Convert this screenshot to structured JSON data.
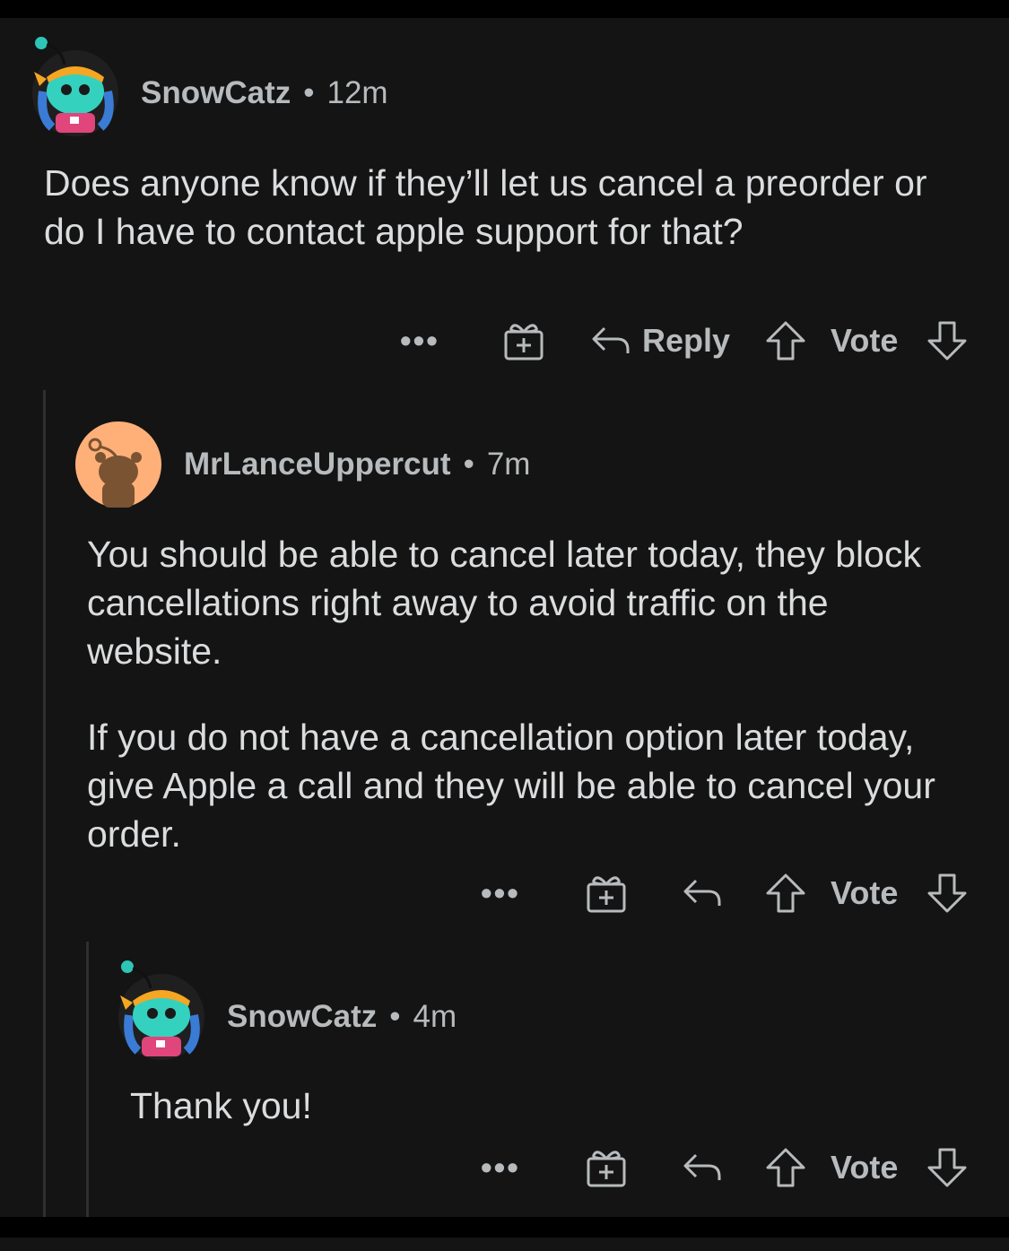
{
  "theme": {
    "background": "#141414",
    "text": "#d7dadc",
    "meta": "#b8bbbd"
  },
  "comments": [
    {
      "username": "SnowCatz",
      "separator": "•",
      "time": "12m",
      "paragraphs": [
        "Does anyone know if they’ll let us cancel a preorder or do I have to contact apple support for that?"
      ],
      "actions": {
        "more": "•••",
        "reply_label": "Reply",
        "vote_label": "Vote"
      }
    },
    {
      "username": "MrLanceUppercut",
      "separator": "•",
      "time": "7m",
      "paragraphs": [
        "You should be able to cancel later today, they block cancellations right away to avoid traffic on the website.",
        "If you do not have a cancellation option later today, give Apple a call and they will be able to cancel your order."
      ],
      "actions": {
        "more": "•••",
        "vote_label": "Vote"
      }
    },
    {
      "username": "SnowCatz",
      "separator": "•",
      "time": "4m",
      "paragraphs": [
        "Thank you!"
      ],
      "actions": {
        "more": "•••",
        "vote_label": "Vote"
      }
    }
  ],
  "icons": {
    "gift": "gift-award-icon",
    "reply": "reply-arrow-icon",
    "upvote": "upvote-arrow-icon",
    "downvote": "downvote-arrow-icon"
  }
}
